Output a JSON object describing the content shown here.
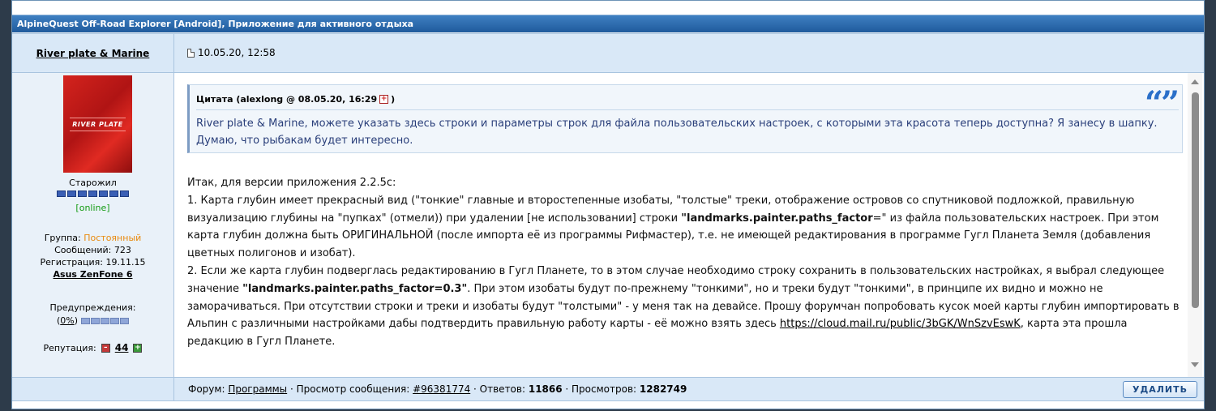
{
  "thread": {
    "title": "AlpineQuest Off-Road Explorer [Android], Приложение для активного отдыха"
  },
  "post": {
    "author": "River plate & Marine",
    "date": "10.05.20, 12:58"
  },
  "author_panel": {
    "avatar_text": "RIVER PLATE",
    "rank": "Старожил",
    "status": "[online]",
    "group_label": "Группа: ",
    "group_value": "Постоянный",
    "messages": "Сообщений: 723",
    "registration": "Регистрация: 19.11.15",
    "device": "Asus ZenFone 6",
    "warnings_label": "Предупреждения:",
    "warnings_open": "(",
    "warnings_value": "0%",
    "warnings_close": ")",
    "reputation_label": "Репутация:",
    "reputation_value": "44",
    "rep_minus": "–",
    "rep_plus": "+"
  },
  "quote": {
    "header": "Цитата (alexlong @ 08.05.20, 16:29",
    "header_close": ")",
    "jump_icon": "+",
    "quote_mark": "“”",
    "text": "River plate & Marine, можете указать здесь строки и параметры строк для файла пользовательских настроек, с которыми эта красота теперь доступна? Я занесу в шапку. Думаю, что рыбакам будет интересно."
  },
  "body": {
    "intro": "Итак, для версии приложения 2.2.5с:",
    "p1_a": "1. Карта глубин имеет прекрасный вид (\"тонкие\" главные и второстепенные изобаты, \"толстые\" треки, отображение островов со спутниковой подложкой, правильную визуализацию глубины на \"пупках\" (отмели)) при удалении [не использовании] строки ",
    "p1_b": "\"landmarks.painter.paths_factor",
    "p1_c": "=\" из файла пользовательских настроек. При этом карта глубин должна быть ОРИГИНАЛЬНОЙ (после импорта её из программы Рифмастер), т.е. не имеющей редактирования в программе Гугл Планета Земля (добавления цветных полигонов и изобат).",
    "p2_a": "2. Если же карта глубин подверглась редактированию в Гугл Планете, то в этом случае необходимо строку сохранить в пользовательских настройках, я выбрал следующее значение ",
    "p2_b": "\"landmarks.painter.paths_factor=0.3\"",
    "p2_c": ". При этом изобаты будут по-прежнему \"тонкими\", но и треки будут \"тонкими\", в принципе их видно и можно не заморачиваться. При отсутствии строки и треки и изобаты будут \"толстыми\" - у меня так на девайсе. Прошу форумчан попробовать кусок моей карты глубин импортировать в Альпин с различными настройками дабы подтвердить правильную работу карты - её можно взять здесь ",
    "link": "https://cloud.mail.ru/public/3bGK/WnSzvEswK",
    "p2_d": ", карта эта прошла редакцию в Гугл Планете."
  },
  "footer": {
    "forum_label": "Форум: ",
    "forum_link": "Программы",
    "view_label": " · Просмотр сообщения: ",
    "view_link": "#96381774",
    "answers_label": " · Ответов: ",
    "answers_value": "11866",
    "views_label": " · Просмотров: ",
    "views_value": "1282749",
    "delete_button": "УДАЛИТЬ"
  },
  "colors": {
    "title_bar": "#2a6aad",
    "row_bg": "#d9e8f7",
    "group_orange": "#e98a0f",
    "online_green": "#149b14",
    "quote_text": "#2a3f7a"
  }
}
